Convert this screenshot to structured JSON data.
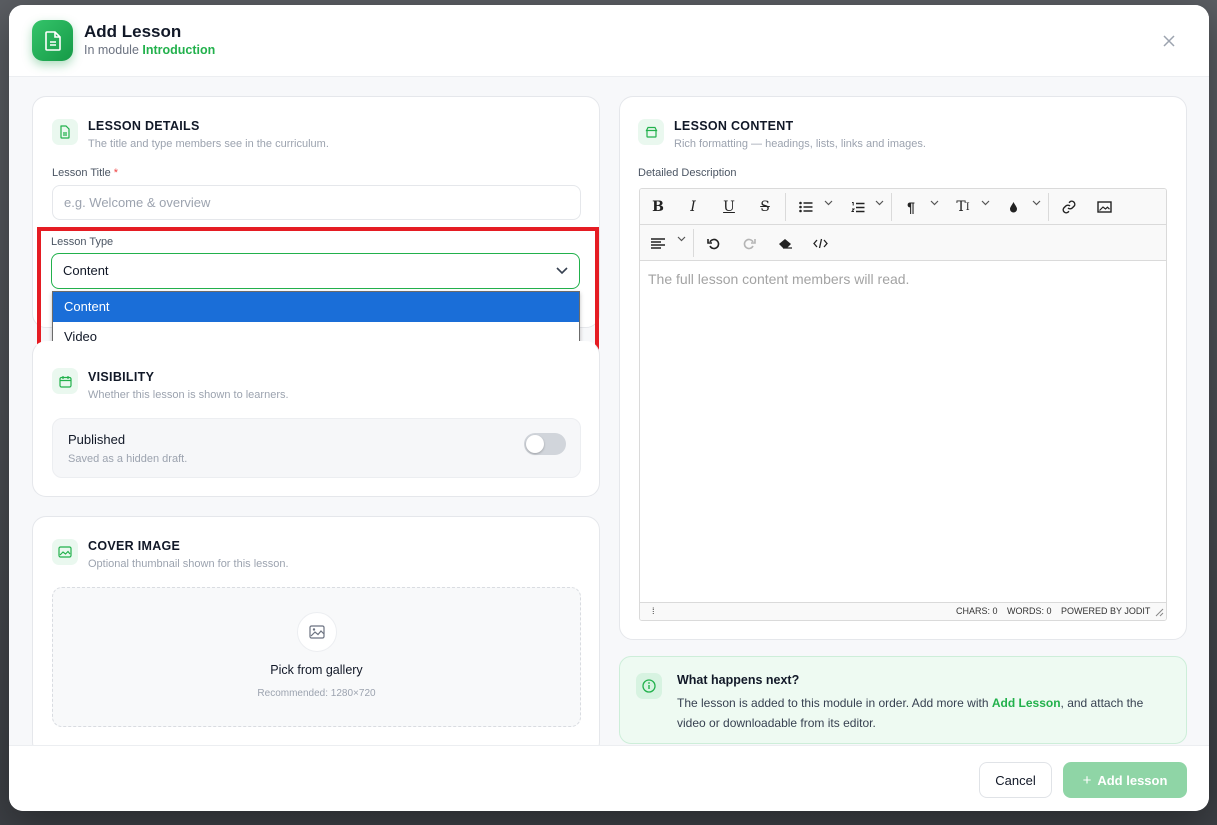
{
  "header": {
    "title": "Add Lesson",
    "subtitle_prefix": "In module",
    "module_name": "Introduction",
    "close_label": "×"
  },
  "lesson_details": {
    "title": "LESSON DETAILS",
    "subtitle": "The title and type members see in the curriculum.",
    "title_label": "Lesson Title",
    "required_mark": "*",
    "title_placeholder": "e.g. Welcome & overview",
    "title_value": "",
    "type_label": "Lesson Type",
    "type_value": "Content",
    "type_options": [
      "Content",
      "Video"
    ],
    "selected_option": "Content"
  },
  "visibility": {
    "title": "VISIBILITY",
    "subtitle": "Whether this lesson is shown to learners.",
    "toggle_label": "Published",
    "toggle_hint": "Saved as a hidden draft.",
    "published": false
  },
  "cover_image": {
    "title": "COVER IMAGE",
    "subtitle": "Optional thumbnail shown for this lesson.",
    "pick_label": "Pick from gallery",
    "recommended": "Recommended: 1280×720"
  },
  "lesson_content": {
    "title": "LESSON CONTENT",
    "subtitle": "Rich formatting — headings, lists, links and images.",
    "field_label": "Detailed Description",
    "placeholder": "The full lesson content members will read.",
    "status": {
      "chars": "CHARS: 0",
      "words": "WORDS: 0",
      "powered": "POWERED BY JODIT"
    }
  },
  "info": {
    "title": "What happens next?",
    "text_before": "The lesson is added to this module in order. Add more with",
    "link": "Add Lesson",
    "text_after": ", and attach the video or downloadable from its editor."
  },
  "footer": {
    "cancel_label": "Cancel",
    "add_label": "Add lesson",
    "add_icon": "+"
  },
  "colors": {
    "accent": "#22b14c",
    "highlight": "#e51c23",
    "selected_option": "#1a6ed8"
  }
}
